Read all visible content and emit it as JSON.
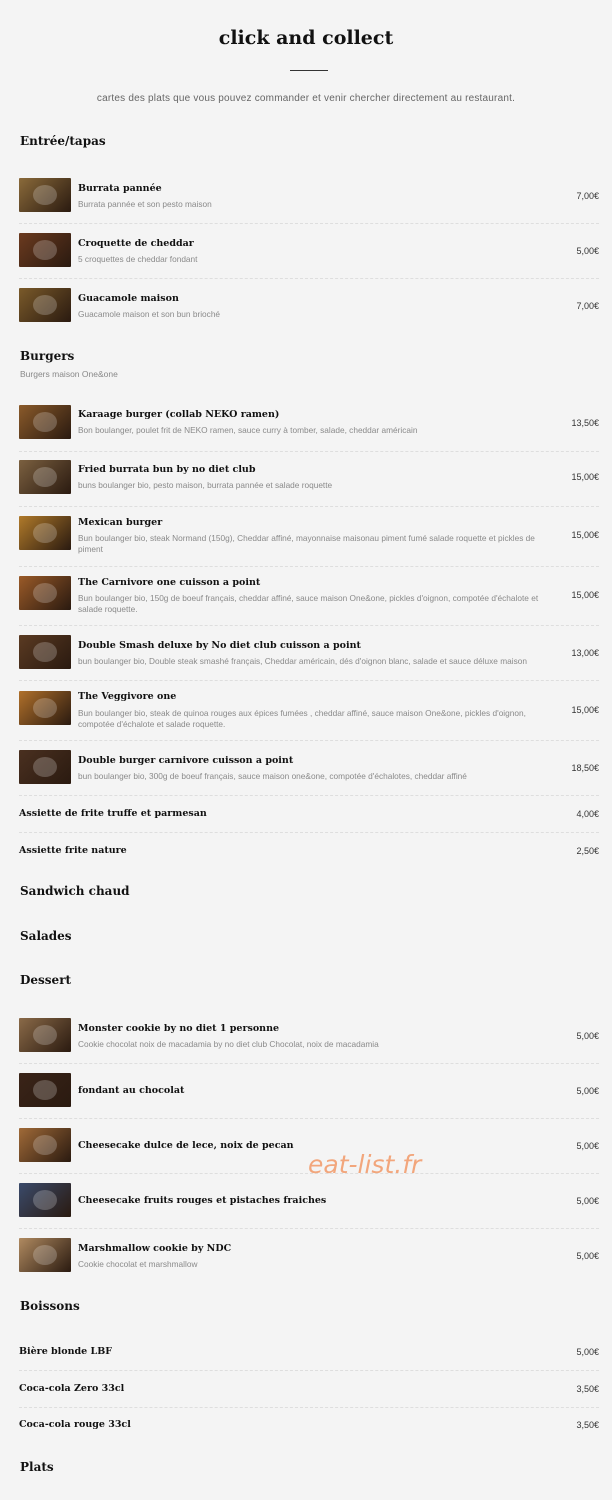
{
  "header": {
    "title": "click and collect",
    "subtitle": "cartes des plats que vous pouvez commander et venir chercher directement au restaurant."
  },
  "sections": {
    "entree": {
      "title": "Entrée/tapas"
    },
    "burgers": {
      "title": "Burgers",
      "desc": "Burgers maison One&one"
    },
    "sandwich": {
      "title": "Sandwich chaud"
    },
    "salades": {
      "title": "Salades"
    },
    "dessert": {
      "title": "Dessert"
    },
    "boissons": {
      "title": "Boissons"
    },
    "plats": {
      "title": "Plats"
    }
  },
  "items": {
    "burrata": {
      "name": "Burrata pannée",
      "desc": "Burrata pannée et son pesto maison",
      "price": "7,00€",
      "thumb_color": "#8a6a3a"
    },
    "croquette": {
      "name": "Croquette de cheddar",
      "desc": "5 croquettes de cheddar fondant",
      "price": "5,00€",
      "thumb_color": "#6b3a1f"
    },
    "guacamole": {
      "name": "Guacamole maison",
      "desc": "Guacamole maison et son bun brioché",
      "price": "7,00€",
      "thumb_color": "#7a5a2a"
    },
    "karaage": {
      "name": "Karaage burger (collab NEKO ramen)",
      "desc": "Bon boulanger, poulet frit de NEKO ramen, sauce curry à tomber, salade, cheddar américain",
      "price": "13,50€",
      "thumb_color": "#8a5a2a"
    },
    "fried_burrata": {
      "name": "Fried burrata bun by no diet club",
      "desc": "buns boulanger bio, pesto maison, burrata pannée et salade roquette",
      "price": "15,00€",
      "thumb_color": "#7b6040"
    },
    "mexican": {
      "name": "Mexican burger",
      "desc": "Bun boulanger bio, steak Normand (150g), Cheddar affiné, mayonnaise maisonau piment fumé salade roquette et pickles de piment",
      "price": "15,00€",
      "thumb_color": "#b07a2a"
    },
    "carnivore": {
      "name": "The Carnivore one cuisson a point",
      "desc": "Bun boulanger bio, 150g de boeuf français, cheddar affiné, sauce maison One&one, pickles d'oignon, compotée d'échalote et salade roquette.",
      "price": "15,00€",
      "thumb_color": "#9a5a28"
    },
    "double_smash": {
      "name": "Double Smash deluxe by No diet club cuisson a point",
      "desc": "bun boulanger bio, Double steak smashé français, Cheddar américain, dés d'oignon blanc, salade et sauce déluxe maison",
      "price": "13,00€",
      "thumb_color": "#5a3a22"
    },
    "veggivore": {
      "name": "The Veggivore one",
      "desc": "Bun boulanger bio, steak de quinoa rouges aux épices fumées , cheddar affiné, sauce maison One&one, pickles d'oignon, compotée d'échalote et salade roquette.",
      "price": "15,00€",
      "thumb_color": "#b0702a"
    },
    "double_carnivore": {
      "name": "Double burger carnivore cuisson a point",
      "desc": "bun boulanger bio, 300g de boeuf français, sauce maison one&one, compotée d'échalotes, cheddar affiné",
      "price": "18,50€",
      "thumb_color": "#4a3020"
    },
    "frite_truffe": {
      "name": "Assiette de frite truffe et parmesan",
      "price": "4,00€"
    },
    "frite_nature": {
      "name": "Assiette frite nature",
      "price": "2,50€"
    },
    "monster_cookie": {
      "name": "Monster cookie by no diet 1 personne",
      "desc": "Cookie chocolat noix de macadamia by no diet club Chocolat, noix de macadamia",
      "price": "5,00€",
      "thumb_color": "#8a6a48"
    },
    "fondant": {
      "name": "fondant au chocolat",
      "price": "5,00€",
      "thumb_color": "#3a2418"
    },
    "cheesecake_dulce": {
      "name": "Cheesecake dulce de lece, noix de pecan",
      "price": "5,00€",
      "thumb_color": "#a06a38"
    },
    "cheesecake_fruits": {
      "name": "Cheesecake fruits rouges et pistaches fraiches",
      "price": "5,00€",
      "thumb_color": "#3a4a6a"
    },
    "marshmallow": {
      "name": "Marshmallow cookie by NDC",
      "desc": "Cookie chocolat et marshmallow",
      "price": "5,00€",
      "thumb_color": "#b08a60"
    },
    "biere": {
      "name": "Bière blonde LBF",
      "price": "5,00€"
    },
    "coca_zero": {
      "name": "Coca-cola Zero 33cl",
      "price": "3,50€"
    },
    "coca_rouge": {
      "name": "Coca-cola rouge 33cl",
      "price": "3,50€"
    }
  },
  "watermark": "eat-list.fr"
}
